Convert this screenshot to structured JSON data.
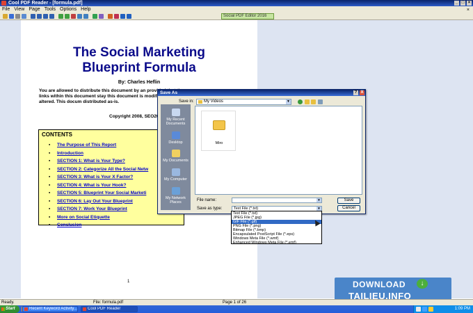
{
  "app": {
    "title": "Cool PDF Reader - [formula.pdf]",
    "menu": [
      "File",
      "View",
      "Page",
      "Tools",
      "Options",
      "Help"
    ],
    "toolbar_zoom": "Social PDF Editor 2016"
  },
  "document": {
    "title_line1": "The Social Marketing",
    "title_line2": "Blueprint Formula",
    "author": "By: Charles Heflin",
    "notice": "You are allowed to distribute this document by an provided that the links within this document stay this document is modified or altered. This docum distributed as-is.",
    "copyright": "Copyright 2008, SEO20/20 Li",
    "contents_title": "CONTENTS",
    "contents": [
      "The Purpose of This Report",
      "Introduction",
      "SECTION 1: What is Your Type?",
      "SECTION 2: Categorize All the Social Netw",
      "SECTION 3: What is Your X Factor?",
      "SECTION 4: What is Your Hook?",
      "SECTION 5: Blueprint Your Social Marketi",
      "SECTION 6: Lay Out Your Blueprint",
      "SECTION 7: Work Your Blueprint",
      "More on Social Etiquette",
      "Conclusion"
    ],
    "page_number": "1"
  },
  "dialog": {
    "title": "Save As",
    "help_btn": "?",
    "close_btn": "X",
    "save_in_label": "Save in:",
    "save_in_value": "My Videos",
    "places": [
      "My Recent Documents",
      "Desktop",
      "My Documents",
      "My Computer",
      "My Network Places"
    ],
    "files": [
      {
        "name": "Miro"
      }
    ],
    "file_name_label": "File name:",
    "file_name_value": "",
    "save_as_type_label": "Save as type:",
    "save_as_type_value": "Text File (*.txt)",
    "save_button": "Save",
    "cancel_button": "Cancel",
    "type_options": [
      "Text File (*.txt)",
      "JPEG File (*.jpg)",
      "GIF File (*.gif)",
      "PNG File (*.png)",
      "Bitmap File (*.bmp)",
      "Encapsulated PostScript File (*.eps)",
      "Windows Meta File (*.wmf)",
      "Enhanced Windows Meta File (*.emf)"
    ],
    "selected_option_index": 2
  },
  "watermark": {
    "download": "DOWNLOAD",
    "site": "TAILIEU.INFO"
  },
  "statusbar": {
    "ready": "Ready.",
    "file": "File: formula.pdf",
    "page": "Page 1 of 26"
  },
  "taskbar": {
    "start": "Start",
    "items": [
      "Recent Keyword Activity...",
      "Cool PDF Reader"
    ],
    "clock": "1:09 PM"
  }
}
